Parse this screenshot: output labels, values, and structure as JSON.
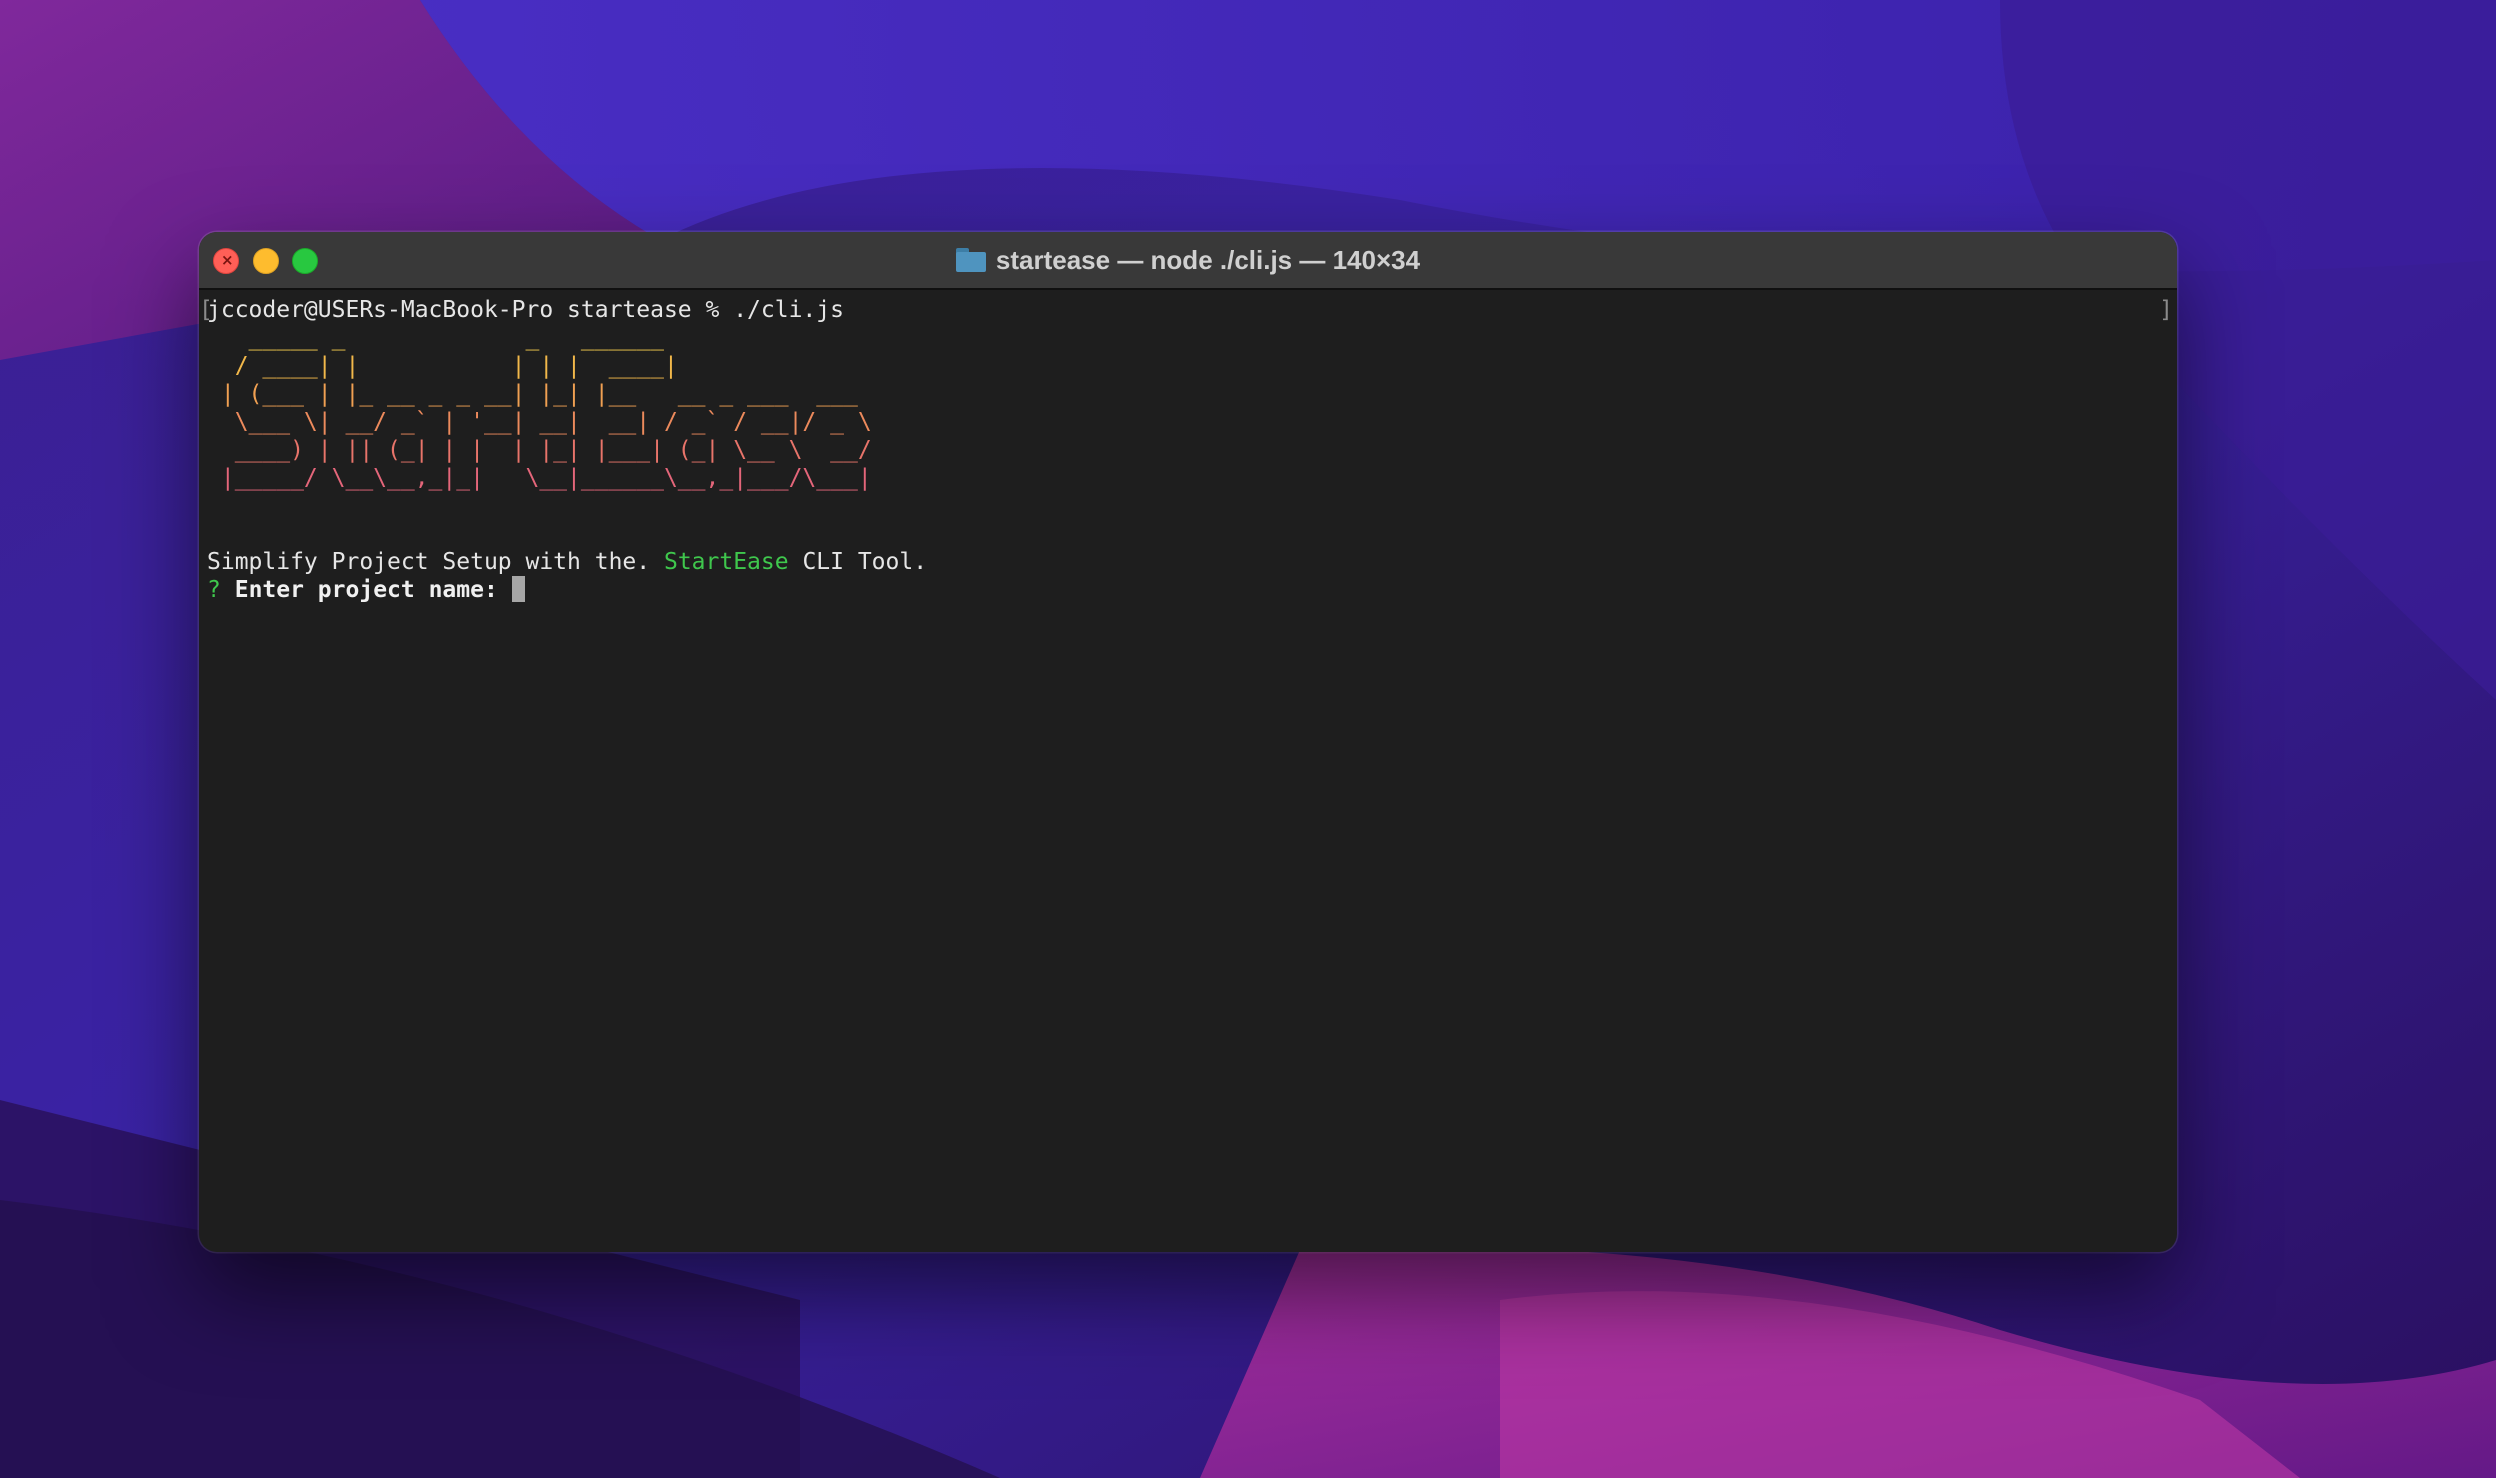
{
  "window": {
    "title": "startease — node ./cli.js — 140×34",
    "folder_icon": "folder-icon",
    "buttons": {
      "close": "close-button",
      "minimize": "minimize-button",
      "zoom": "zoom-button"
    }
  },
  "terminal": {
    "prompt_line": "jccoder@USERs-MacBook-Pro startease % ./cli.js",
    "bracket_left": "[",
    "bracket_right": "]",
    "banner": [
      "   _____ _             _   ______",
      "  / ____| |           | | |  ____|",
      " | (___ | |_ __ _ _ __| |_| |__   __ _ ___  ___",
      "  \\___ \\| __/ _` | '__| __|  __| / _` / __|/ _ \\",
      "  ____) | || (_| | |  | |_| |___| (_| \\__ \\  __/",
      " |_____/ \\__\\__,_|_|   \\__|______\\__,_|___/\\___|"
    ],
    "tagline_before": "Simplify Project Setup with the. ",
    "tagline_highlight": "StartEase",
    "tagline_after": " CLI Tool.",
    "question_mark": "?",
    "question_text": "Enter project name:",
    "input_value": ""
  },
  "colors": {
    "close": "#ff5f57",
    "minimize": "#febc2e",
    "zoom": "#28c840",
    "terminal_bg": "#1e1e1e",
    "highlight_green": "#3fc74d"
  }
}
